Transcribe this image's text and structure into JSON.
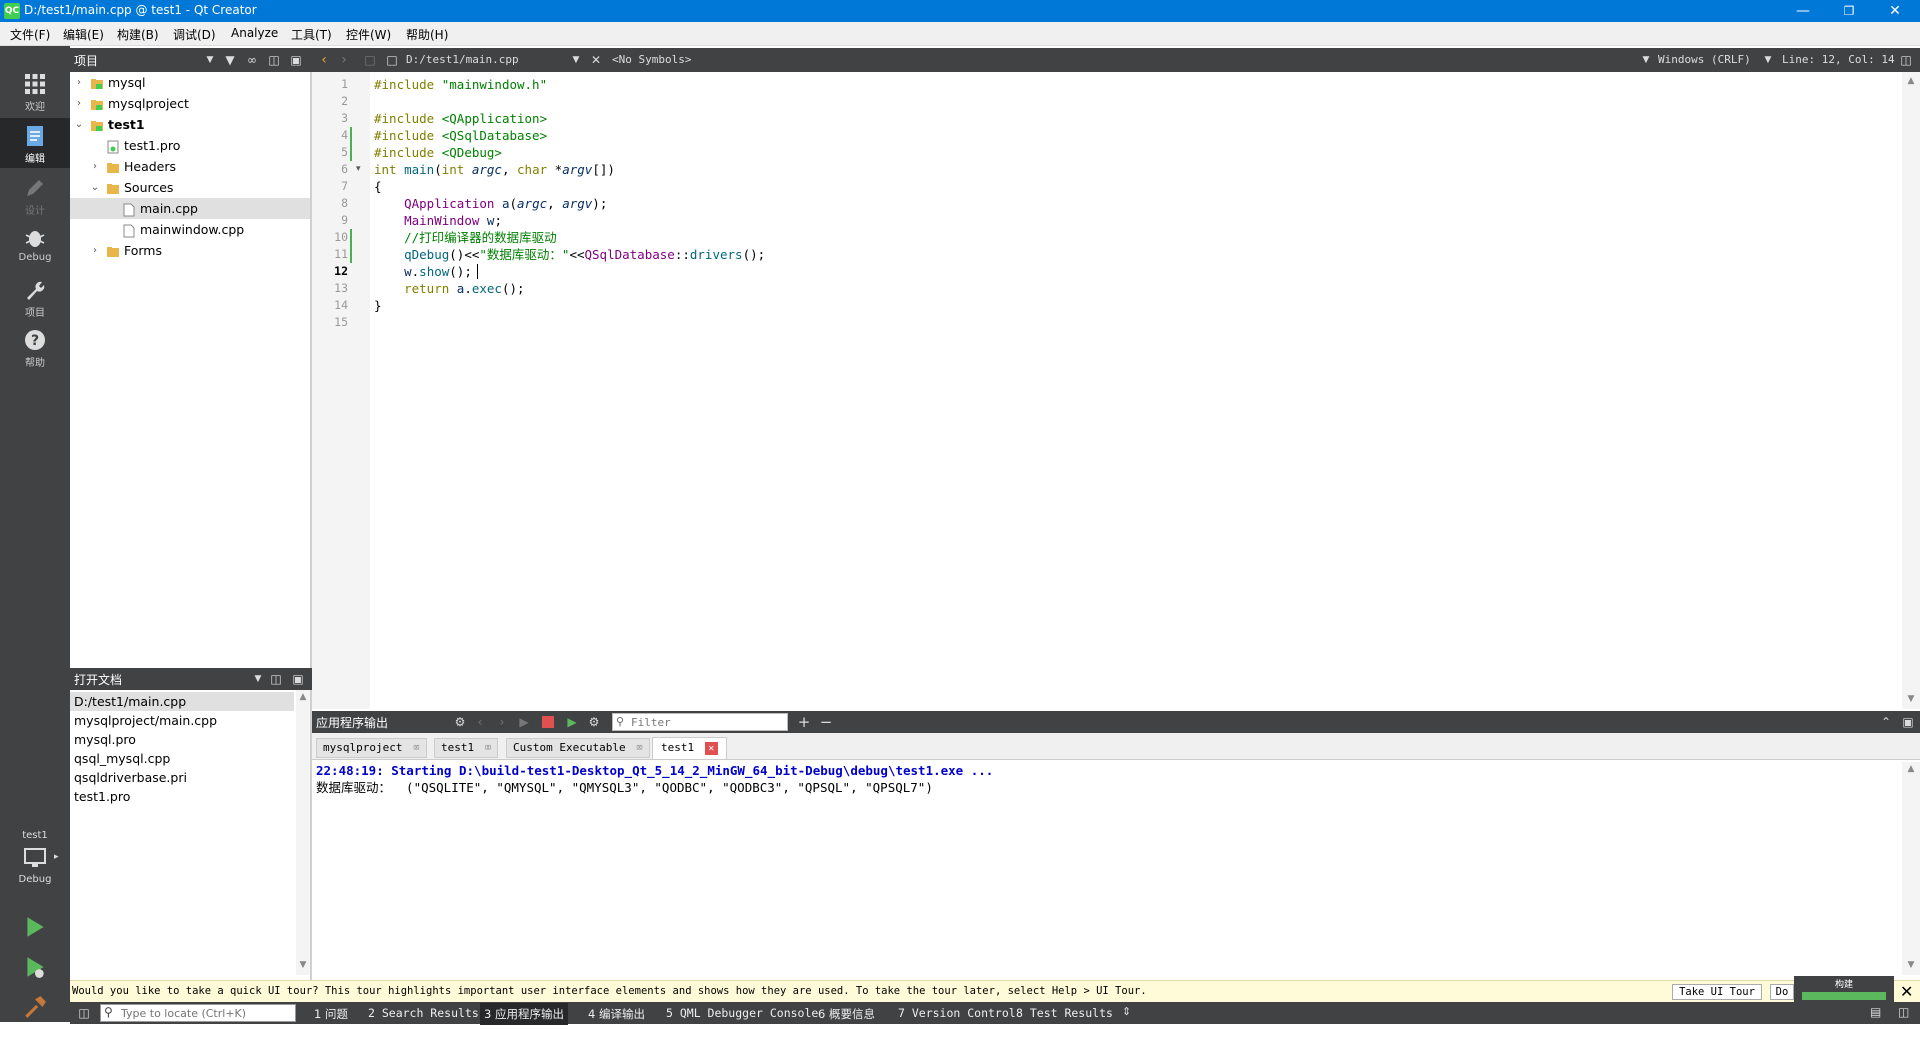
{
  "window": {
    "title": "D:/test1/main.cpp @ test1 - Qt Creator",
    "logo": "QC"
  },
  "menu": [
    "文件(F)",
    "编辑(E)",
    "构建(B)",
    "调试(D)",
    "Analyze",
    "工具(T)",
    "控件(W)",
    "帮助(H)"
  ],
  "modes": {
    "welcome": "欢迎",
    "edit": "编辑",
    "design": "设计",
    "debug": "Debug",
    "projects": "项目",
    "help": "帮助",
    "target_project": "test1",
    "target_config": "Debug"
  },
  "projects_pane": {
    "title": "项目"
  },
  "tree": [
    {
      "label": "mysql",
      "level": 0,
      "arrow": "›",
      "icon": "project"
    },
    {
      "label": "mysqlproject",
      "level": 0,
      "arrow": "›",
      "icon": "project"
    },
    {
      "label": "test1",
      "level": 0,
      "arrow": "⌄",
      "icon": "project",
      "bold": true
    },
    {
      "label": "test1.pro",
      "level": 1,
      "arrow": "",
      "icon": "pro"
    },
    {
      "label": "Headers",
      "level": 1,
      "arrow": "›",
      "icon": "folder"
    },
    {
      "label": "Sources",
      "level": 1,
      "arrow": "⌄",
      "icon": "folder"
    },
    {
      "label": "main.cpp",
      "level": 2,
      "arrow": "",
      "icon": "file",
      "selected": true
    },
    {
      "label": "mainwindow.cpp",
      "level": 2,
      "arrow": "",
      "icon": "file"
    },
    {
      "label": "Forms",
      "level": 1,
      "arrow": "›",
      "icon": "folder"
    }
  ],
  "open_docs": {
    "title": "打开文档",
    "items": [
      "D:/test1/main.cpp",
      "mysqlproject/main.cpp",
      "mysql.pro",
      "qsql_mysql.cpp",
      "qsqldriverbase.pri",
      "test1.pro"
    ]
  },
  "editor": {
    "file_path": "D:/test1/main.cpp",
    "symbols": "<No Symbols>",
    "line_ending": "Windows (CRLF)",
    "position": "Line: 12, Col: 14",
    "line_numbers": [
      "1",
      "2",
      "3",
      "4",
      "5",
      "6",
      "7",
      "8",
      "9",
      "10",
      "11",
      "12",
      "13",
      "14",
      "15"
    ],
    "lines": [
      {
        "t": "#include \"mainwindow.h\""
      },
      {
        "t": ""
      },
      {
        "t": "#include <QApplication>"
      },
      {
        "t": "#include <QSqlDatabase>"
      },
      {
        "t": "#include <QDebug>"
      },
      {
        "t": "int main(int argc, char *argv[])"
      },
      {
        "t": "{"
      },
      {
        "t": "    QApplication a(argc, argv);"
      },
      {
        "t": "    MainWindow w;"
      },
      {
        "t": "    //打印编译器的数据库驱动"
      },
      {
        "t": "    qDebug()<<\"数据库驱动：\"<<QSqlDatabase::drivers();"
      },
      {
        "t": "    w.show();"
      },
      {
        "t": "    return a.exec();"
      },
      {
        "t": "}"
      },
      {
        "t": ""
      }
    ]
  },
  "output": {
    "title": "应用程序输出",
    "filter_placeholder": "Filter",
    "tabs": [
      "mysqlproject",
      "test1",
      "Custom Executable",
      "test1"
    ],
    "lines": [
      "22:48:19: Starting D:\\build-test1-Desktop_Qt_5_14_2_MinGW_64_bit-Debug\\debug\\test1.exe ...",
      "数据库驱动：  (\"QSQLITE\", \"QMYSQL\", \"QMYSQL3\", \"QODBC\", \"QODBC3\", \"QPSQL\", \"QPSQL7\")"
    ]
  },
  "tour": {
    "message": "Would you like to take a quick UI tour? This tour highlights important user interface elements and shows how they are used. To take the tour later, select Help > UI Tour.",
    "take_button": "Take UI Tour",
    "dont_button": "Do",
    "progress_label": "构建"
  },
  "bottom": {
    "locate_placeholder": "Type to locate (Ctrl+K)",
    "tabs": [
      "1 问题",
      "2 Search Results",
      "3 应用程序输出",
      "4 编译输出",
      "5 QML Debugger Console",
      "6 概要信息",
      "7 Version Control",
      "8 Test Results"
    ]
  },
  "colors": {
    "accent": "#0078d7",
    "sidebar": "#404244",
    "qt_green": "#41cd52"
  }
}
